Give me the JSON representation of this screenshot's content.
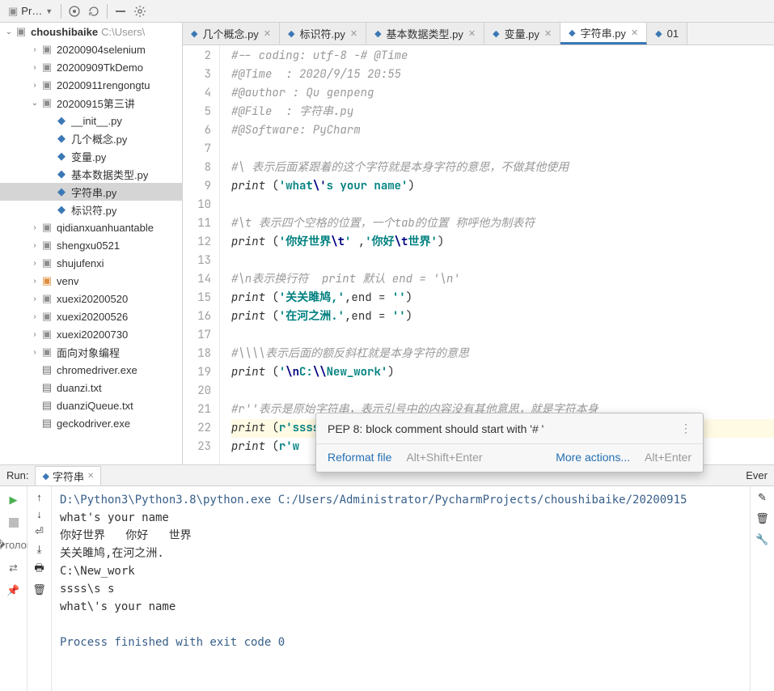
{
  "toolbar": {
    "project_label": "Pr…"
  },
  "tree": {
    "root": {
      "name": "choushibaike",
      "path": "C:\\Users\\"
    },
    "items": [
      {
        "indent": 2,
        "arrow": "›",
        "icon": "folder-gray",
        "label": "20200904selenium"
      },
      {
        "indent": 2,
        "arrow": "›",
        "icon": "folder-gray",
        "label": "20200909TkDemo"
      },
      {
        "indent": 2,
        "arrow": "›",
        "icon": "folder-gray",
        "label": "20200911rengongtu"
      },
      {
        "indent": 2,
        "arrow": "⌄",
        "icon": "folder-gray",
        "label": "20200915第三讲"
      },
      {
        "indent": 3,
        "arrow": "",
        "icon": "py",
        "label": "__init__.py"
      },
      {
        "indent": 3,
        "arrow": "",
        "icon": "py",
        "label": "几个概念.py"
      },
      {
        "indent": 3,
        "arrow": "",
        "icon": "py",
        "label": "变量.py"
      },
      {
        "indent": 3,
        "arrow": "",
        "icon": "py",
        "label": "基本数据类型.py"
      },
      {
        "indent": 3,
        "arrow": "",
        "icon": "py",
        "label": "字符串.py",
        "selected": true
      },
      {
        "indent": 3,
        "arrow": "",
        "icon": "py",
        "label": "标识符.py"
      },
      {
        "indent": 2,
        "arrow": "›",
        "icon": "folder-gray",
        "label": "qidianxuanhuantable"
      },
      {
        "indent": 2,
        "arrow": "›",
        "icon": "folder-gray",
        "label": "shengxu0521"
      },
      {
        "indent": 2,
        "arrow": "›",
        "icon": "folder-gray",
        "label": "shujufenxi"
      },
      {
        "indent": 2,
        "arrow": "›",
        "icon": "folder-orange",
        "label": "venv"
      },
      {
        "indent": 2,
        "arrow": "›",
        "icon": "folder-gray",
        "label": "xuexi20200520"
      },
      {
        "indent": 2,
        "arrow": "›",
        "icon": "folder-gray",
        "label": "xuexi20200526"
      },
      {
        "indent": 2,
        "arrow": "›",
        "icon": "folder-gray",
        "label": "xuexi20200730"
      },
      {
        "indent": 2,
        "arrow": "›",
        "icon": "folder-gray",
        "label": "面向对象编程"
      },
      {
        "indent": 2,
        "arrow": "",
        "icon": "txt",
        "label": "chromedriver.exe"
      },
      {
        "indent": 2,
        "arrow": "",
        "icon": "txt",
        "label": "duanzi.txt"
      },
      {
        "indent": 2,
        "arrow": "",
        "icon": "txt",
        "label": "duanziQueue.txt"
      },
      {
        "indent": 2,
        "arrow": "",
        "icon": "txt",
        "label": "geckodriver.exe"
      }
    ]
  },
  "tabs": [
    {
      "label": "几个概念.py",
      "active": false
    },
    {
      "label": "标识符.py",
      "active": false
    },
    {
      "label": "基本数据类型.py",
      "active": false
    },
    {
      "label": "变量.py",
      "active": false
    },
    {
      "label": "字符串.py",
      "active": true
    },
    {
      "label": "01",
      "active": false,
      "noclose": true
    }
  ],
  "editor": {
    "first_line": 2,
    "lines": [
      {
        "n": 2,
        "html": "<span class='cm'>#-- coding: utf-8 -# @Time</span>"
      },
      {
        "n": 3,
        "html": "<span class='cm'>#@Time  : 2020/9/15 20:55</span>"
      },
      {
        "n": 4,
        "html": "<span class='cm'>#@author : Qu genpeng</span>"
      },
      {
        "n": 5,
        "html": "<span class='cm'>#@File  : 字符串.py</span>"
      },
      {
        "n": 6,
        "html": "<span class='cm'>#@Software: PyCharm</span>"
      },
      {
        "n": 7,
        "html": ""
      },
      {
        "n": 8,
        "html": "<span class='cm'>#\\ 表示后面紧跟着的这个字符就是本身字符的意思，不做其他使用</span>"
      },
      {
        "n": 9,
        "html": "<span class='fn'>print</span> (<span class='str'>'what<span class='esc'>\\'</span>s your name'</span>)"
      },
      {
        "n": 10,
        "html": ""
      },
      {
        "n": 11,
        "html": "<span class='cm'>#\\t 表示四个空格的位置，一个tab的位置 称呼他为制表符</span>"
      },
      {
        "n": 12,
        "html": "<span class='fn'>print</span> (<span class='str'>'你好世界<span class='esc'>\\t</span>'</span> ,<span class='str'>'你好<span class='esc'>\\t</span>世界'</span>)"
      },
      {
        "n": 13,
        "html": ""
      },
      {
        "n": 14,
        "html": "<span class='cm'>#\\n表示换行符  print 默认 end = '\\n'</span>"
      },
      {
        "n": 15,
        "html": "<span class='fn'>print</span> (<span class='str'>'关关雎鸠,'</span>,end = <span class='str'>''</span>)"
      },
      {
        "n": 16,
        "html": "<span class='fn'>print</span> (<span class='str'>'在河之洲.'</span>,end = <span class='str'>''</span>)"
      },
      {
        "n": 17,
        "html": ""
      },
      {
        "n": 18,
        "html": "<span class='cm'>#\\\\\\\\表示后面的额反斜杠就是本身字符的意思</span>"
      },
      {
        "n": 19,
        "html": "<span class='fn'>print</span> (<span class='str'>'<span class='esc'>\\n</span>C:<span class='esc'>\\\\</span>New_work'</span>)"
      },
      {
        "n": 20,
        "html": ""
      },
      {
        "n": 21,
        "html": "<span class='cm'>#r''表示是原始字符串，表示引号中的内容没有其他意思，就是字符本身</span>"
      },
      {
        "n": 22,
        "html": "<span class='fn'>print</span> (<span class='str'>r'ssss\\s s'</span>)",
        "hl": true
      },
      {
        "n": 23,
        "html": "<span class='fn'>print</span> (<span class='str'>r'w</span>"
      }
    ]
  },
  "popup": {
    "title": "PEP 8: block comment should start with '# '",
    "reformat": "Reformat file",
    "reformat_sc": "Alt+Shift+Enter",
    "more": "More actions...",
    "more_sc": "Alt+Enter"
  },
  "run": {
    "label": "Run:",
    "tab": "字符串",
    "right_label": "Ever",
    "lines": [
      {
        "cls": "path-line",
        "text": "D:\\Python3\\Python3.8\\python.exe C:/Users/Administrator/PycharmProjects/choushibaike/20200915"
      },
      {
        "cls": "",
        "text": "what's your name"
      },
      {
        "cls": "",
        "text": "你好世界   你好   世界"
      },
      {
        "cls": "",
        "text": "关关雎鸠,在河之洲."
      },
      {
        "cls": "",
        "text": "C:\\New_work"
      },
      {
        "cls": "",
        "text": "ssss\\s s"
      },
      {
        "cls": "",
        "text": "what\\'s your name"
      },
      {
        "cls": "",
        "text": ""
      },
      {
        "cls": "exit-line",
        "text": "Process finished with exit code 0"
      }
    ]
  }
}
